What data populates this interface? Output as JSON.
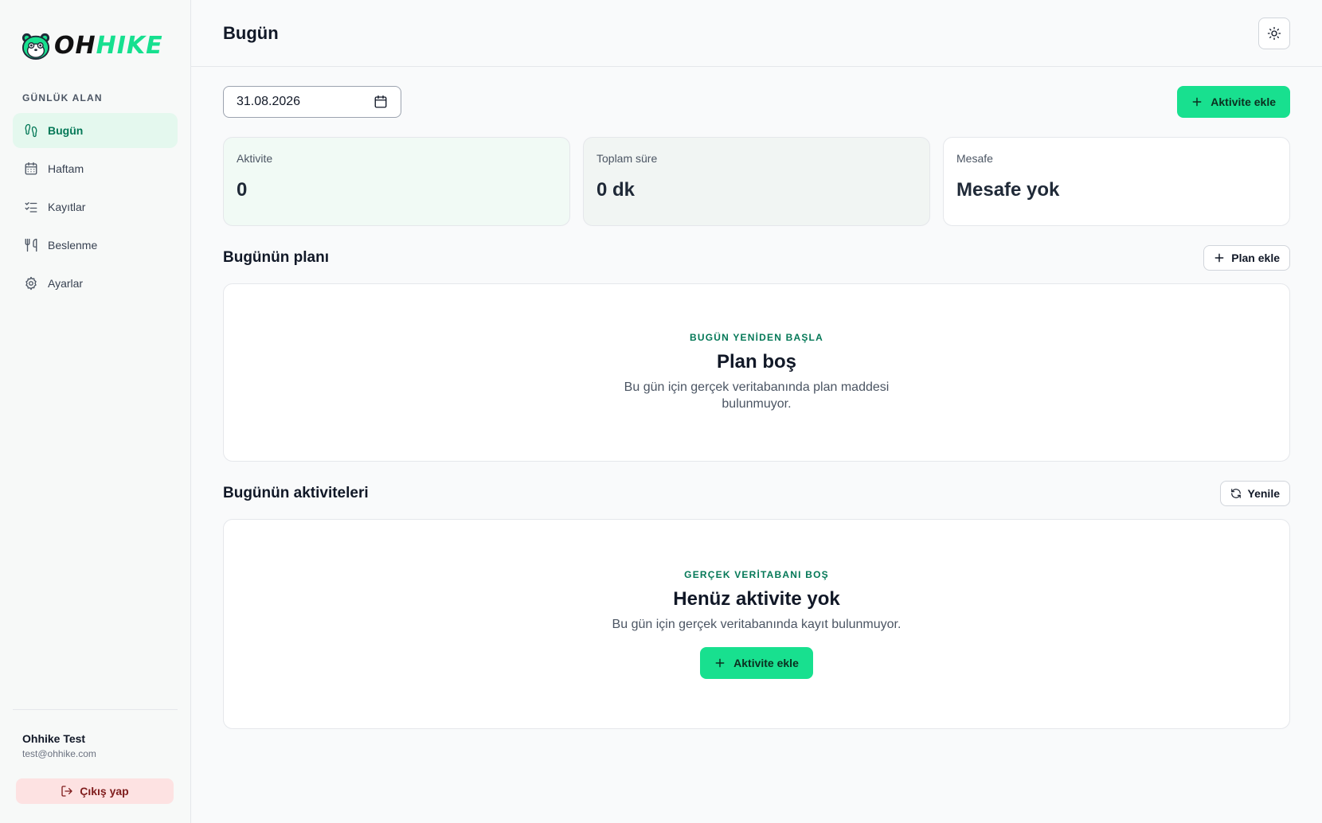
{
  "brand": {
    "part1": "OH",
    "part2": "HIKE"
  },
  "sidebar": {
    "section_label": "GÜNLÜK ALAN",
    "items": [
      {
        "label": "Bugün",
        "icon": "footprints-icon",
        "active": true
      },
      {
        "label": "Haftam",
        "icon": "calendar-icon",
        "active": false
      },
      {
        "label": "Kayıtlar",
        "icon": "checklist-icon",
        "active": false
      },
      {
        "label": "Beslenme",
        "icon": "utensils-icon",
        "active": false
      },
      {
        "label": "Ayarlar",
        "icon": "gear-icon",
        "active": false
      }
    ],
    "user": {
      "name": "Ohhike Test",
      "email": "test@ohhike.com"
    },
    "logout_label": "Çıkış yap"
  },
  "header": {
    "title": "Bugün",
    "theme_icon": "sun-icon"
  },
  "toolbar": {
    "date_value": "31.08.2026",
    "add_activity_label": "Aktivite ekle"
  },
  "stats": [
    {
      "label": "Aktivite",
      "value": "0"
    },
    {
      "label": "Toplam süre",
      "value": "0 dk"
    },
    {
      "label": "Mesafe",
      "value": "Mesafe yok"
    }
  ],
  "plan": {
    "title": "Bugünün planı",
    "add_label": "Plan ekle",
    "empty": {
      "eyebrow": "BUGÜN YENİDEN BAŞLA",
      "title": "Plan boş",
      "description": "Bu gün için gerçek veritabanında plan maddesi bulunmuyor."
    }
  },
  "activities": {
    "title": "Bugünün aktiviteleri",
    "refresh_label": "Yenile",
    "empty": {
      "eyebrow": "GERÇEK VERİTABANI BOŞ",
      "title": "Henüz aktivite yok",
      "description": "Bu gün için gerçek veritabanında kayıt bulunmuyor.",
      "cta_label": "Aktivite ekle"
    }
  },
  "colors": {
    "accent": "#18e08f",
    "accent_dark": "#047857",
    "logout_bg": "#fde2e2"
  }
}
